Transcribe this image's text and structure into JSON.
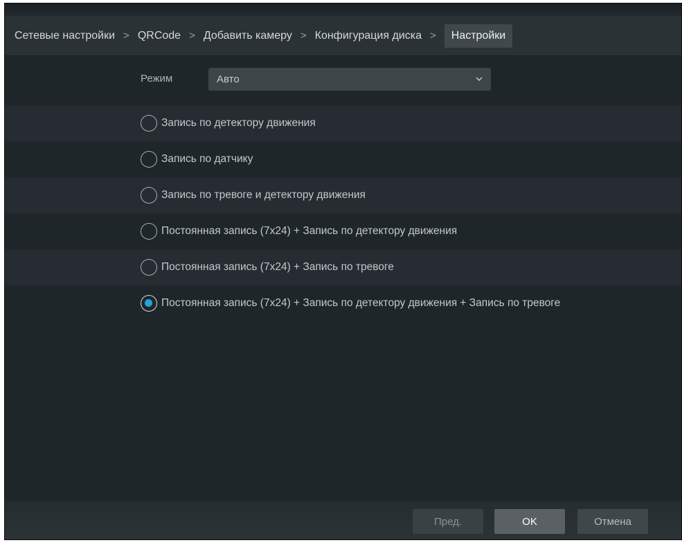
{
  "breadcrumb": {
    "items": [
      {
        "label": "Сетевые настройки"
      },
      {
        "label": "QRCode"
      },
      {
        "label": "Добавить камеру"
      },
      {
        "label": "Конфигурация диска"
      },
      {
        "label": "Настройки",
        "active": true
      }
    ],
    "separator": ">"
  },
  "mode": {
    "label": "Режим",
    "selected": "Авто",
    "icon": "chevron-down-icon"
  },
  "options": [
    {
      "label": "Запись по детектору движения",
      "checked": false
    },
    {
      "label": "Запись по датчику",
      "checked": false
    },
    {
      "label": "Запись по тревоге и детектору движения",
      "checked": false
    },
    {
      "label": "Постоянная запись (7x24) + Запись по детектору движения",
      "checked": false
    },
    {
      "label": "Постоянная запись (7x24) + Запись по тревоге",
      "checked": false
    },
    {
      "label": "Постоянная запись (7x24) + Запись по детектору движения + Запись по тревоге",
      "checked": true
    }
  ],
  "footer": {
    "prev_label": "Пред.",
    "ok_label": "OK",
    "cancel_label": "Отмена"
  },
  "colors": {
    "background": "#1f2629",
    "band": "#262c31",
    "accent": "#1fa3d8"
  }
}
